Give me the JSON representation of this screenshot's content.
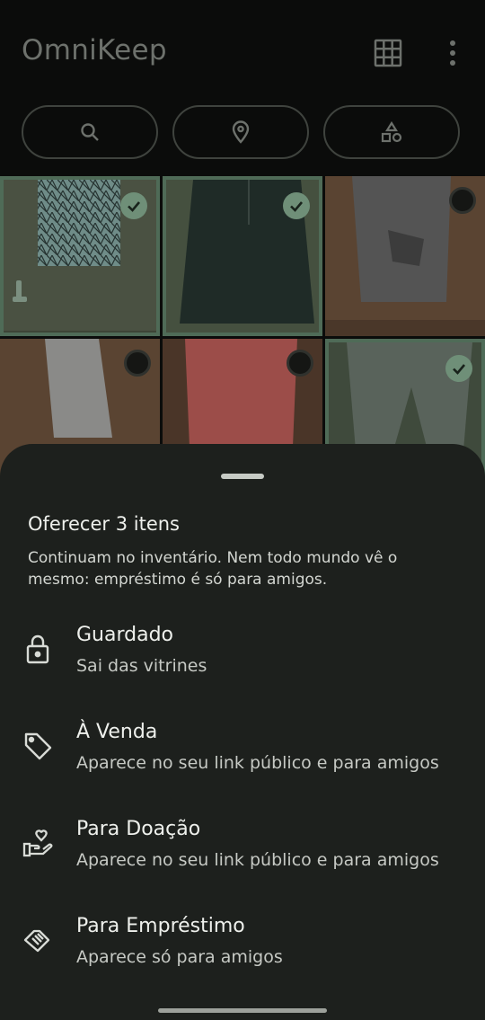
{
  "app": {
    "title": "OmniKeep"
  },
  "toolbar": {
    "grid_icon": "grid-view-icon",
    "menu_icon": "more-vert-icon"
  },
  "filters": [
    {
      "icon": "search-icon"
    },
    {
      "icon": "location-pin-icon"
    },
    {
      "icon": "shapes-category-icon"
    }
  ],
  "photos": [
    {
      "selected": true
    },
    {
      "selected": true
    },
    {
      "selected": false
    },
    {
      "selected": false
    },
    {
      "selected": false
    },
    {
      "selected": true
    }
  ],
  "sheet": {
    "title": "Oferecer 3 itens",
    "description": "Continuam no inventário. Nem todo mundo vê o mesmo: empréstimo é só para amigos.",
    "options": [
      {
        "icon": "lock-icon",
        "label": "Guardado",
        "subtitle": "Sai das vitrines"
      },
      {
        "icon": "tag-icon",
        "label": "À Venda",
        "subtitle": "Aparece no seu link público e para amigos"
      },
      {
        "icon": "hand-heart-icon",
        "label": "Para Doação",
        "subtitle": "Aparece no seu link público e para amigos"
      },
      {
        "icon": "handshake-icon",
        "label": "Para Empréstimo",
        "subtitle": "Aparece só para amigos"
      }
    ]
  },
  "colors": {
    "background": "#0b0c0b",
    "sheet": "#1d201d",
    "accent": "#6f8f78"
  }
}
